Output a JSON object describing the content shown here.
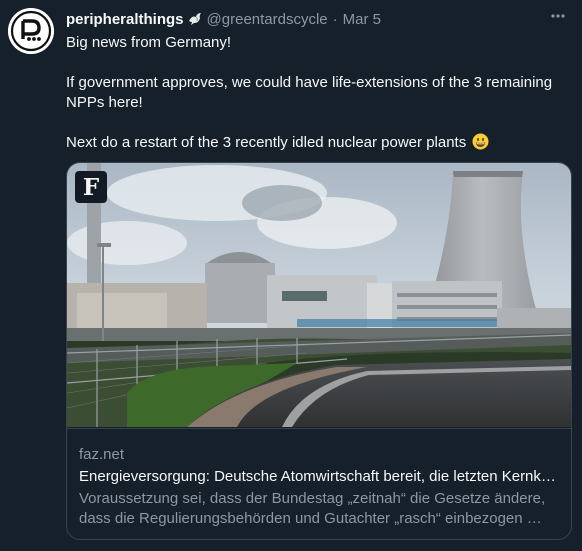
{
  "tweet": {
    "author_name": "peripheralthings",
    "handle": "@greentardscycle",
    "separator": "·",
    "date": "Mar 5",
    "paragraphs": [
      "Big news from Germany!",
      "If government approves, we could have life-extensions of the 3 remaining NPPs here!",
      "Next do a restart of the 3 recently idled nuclear power plants"
    ],
    "emoji": "grinning-face-icon",
    "card": {
      "logo_letter": "F",
      "domain": "faz.net",
      "headline": "Energieversorgung: Deutsche Atomwirtschaft bereit, die letzten Kernkraftwerke länger laufen zu lassen",
      "description_line1": "Voraussetzung sei, dass der Bundestag „zeitnah“ die Gesetze ändere,",
      "description_line2": "dass die Regulierungsbehörden und Gutachter „rasch“ einbezogen würden."
    }
  },
  "colors": {
    "background": "#15202b",
    "text": "#f7f9f9",
    "secondary": "#8b98a5",
    "border": "#38444d"
  }
}
